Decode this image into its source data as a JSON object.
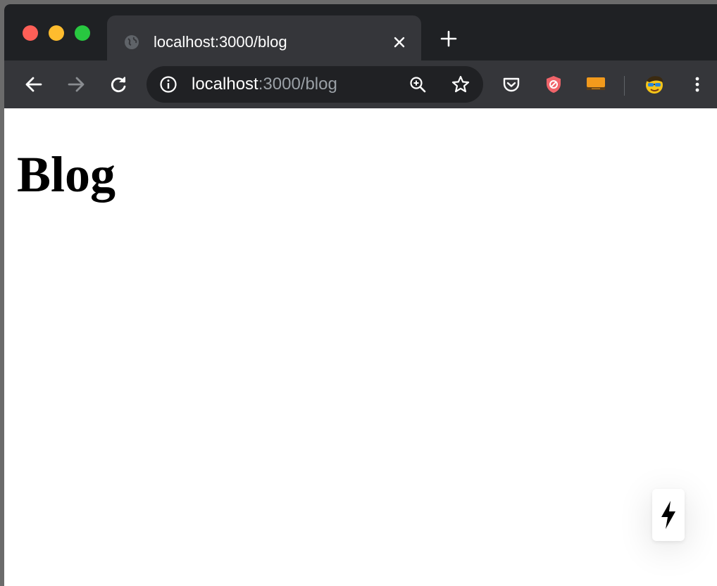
{
  "browser": {
    "tab": {
      "title": "localhost:3000/blog",
      "favicon": "globe-icon"
    },
    "address_bar": {
      "host": "localhost",
      "path": ":3000/blog"
    },
    "extensions": [
      "pocket-icon",
      "shield-extension-icon",
      "amazon-extension-icon"
    ],
    "profile": "profile-avatar"
  },
  "page": {
    "heading": "Blog"
  },
  "colors": {
    "titlebar": "#1f2124",
    "toolbar": "#35363a",
    "omnibox": "#202124",
    "url_muted": "#9aa0a6"
  }
}
